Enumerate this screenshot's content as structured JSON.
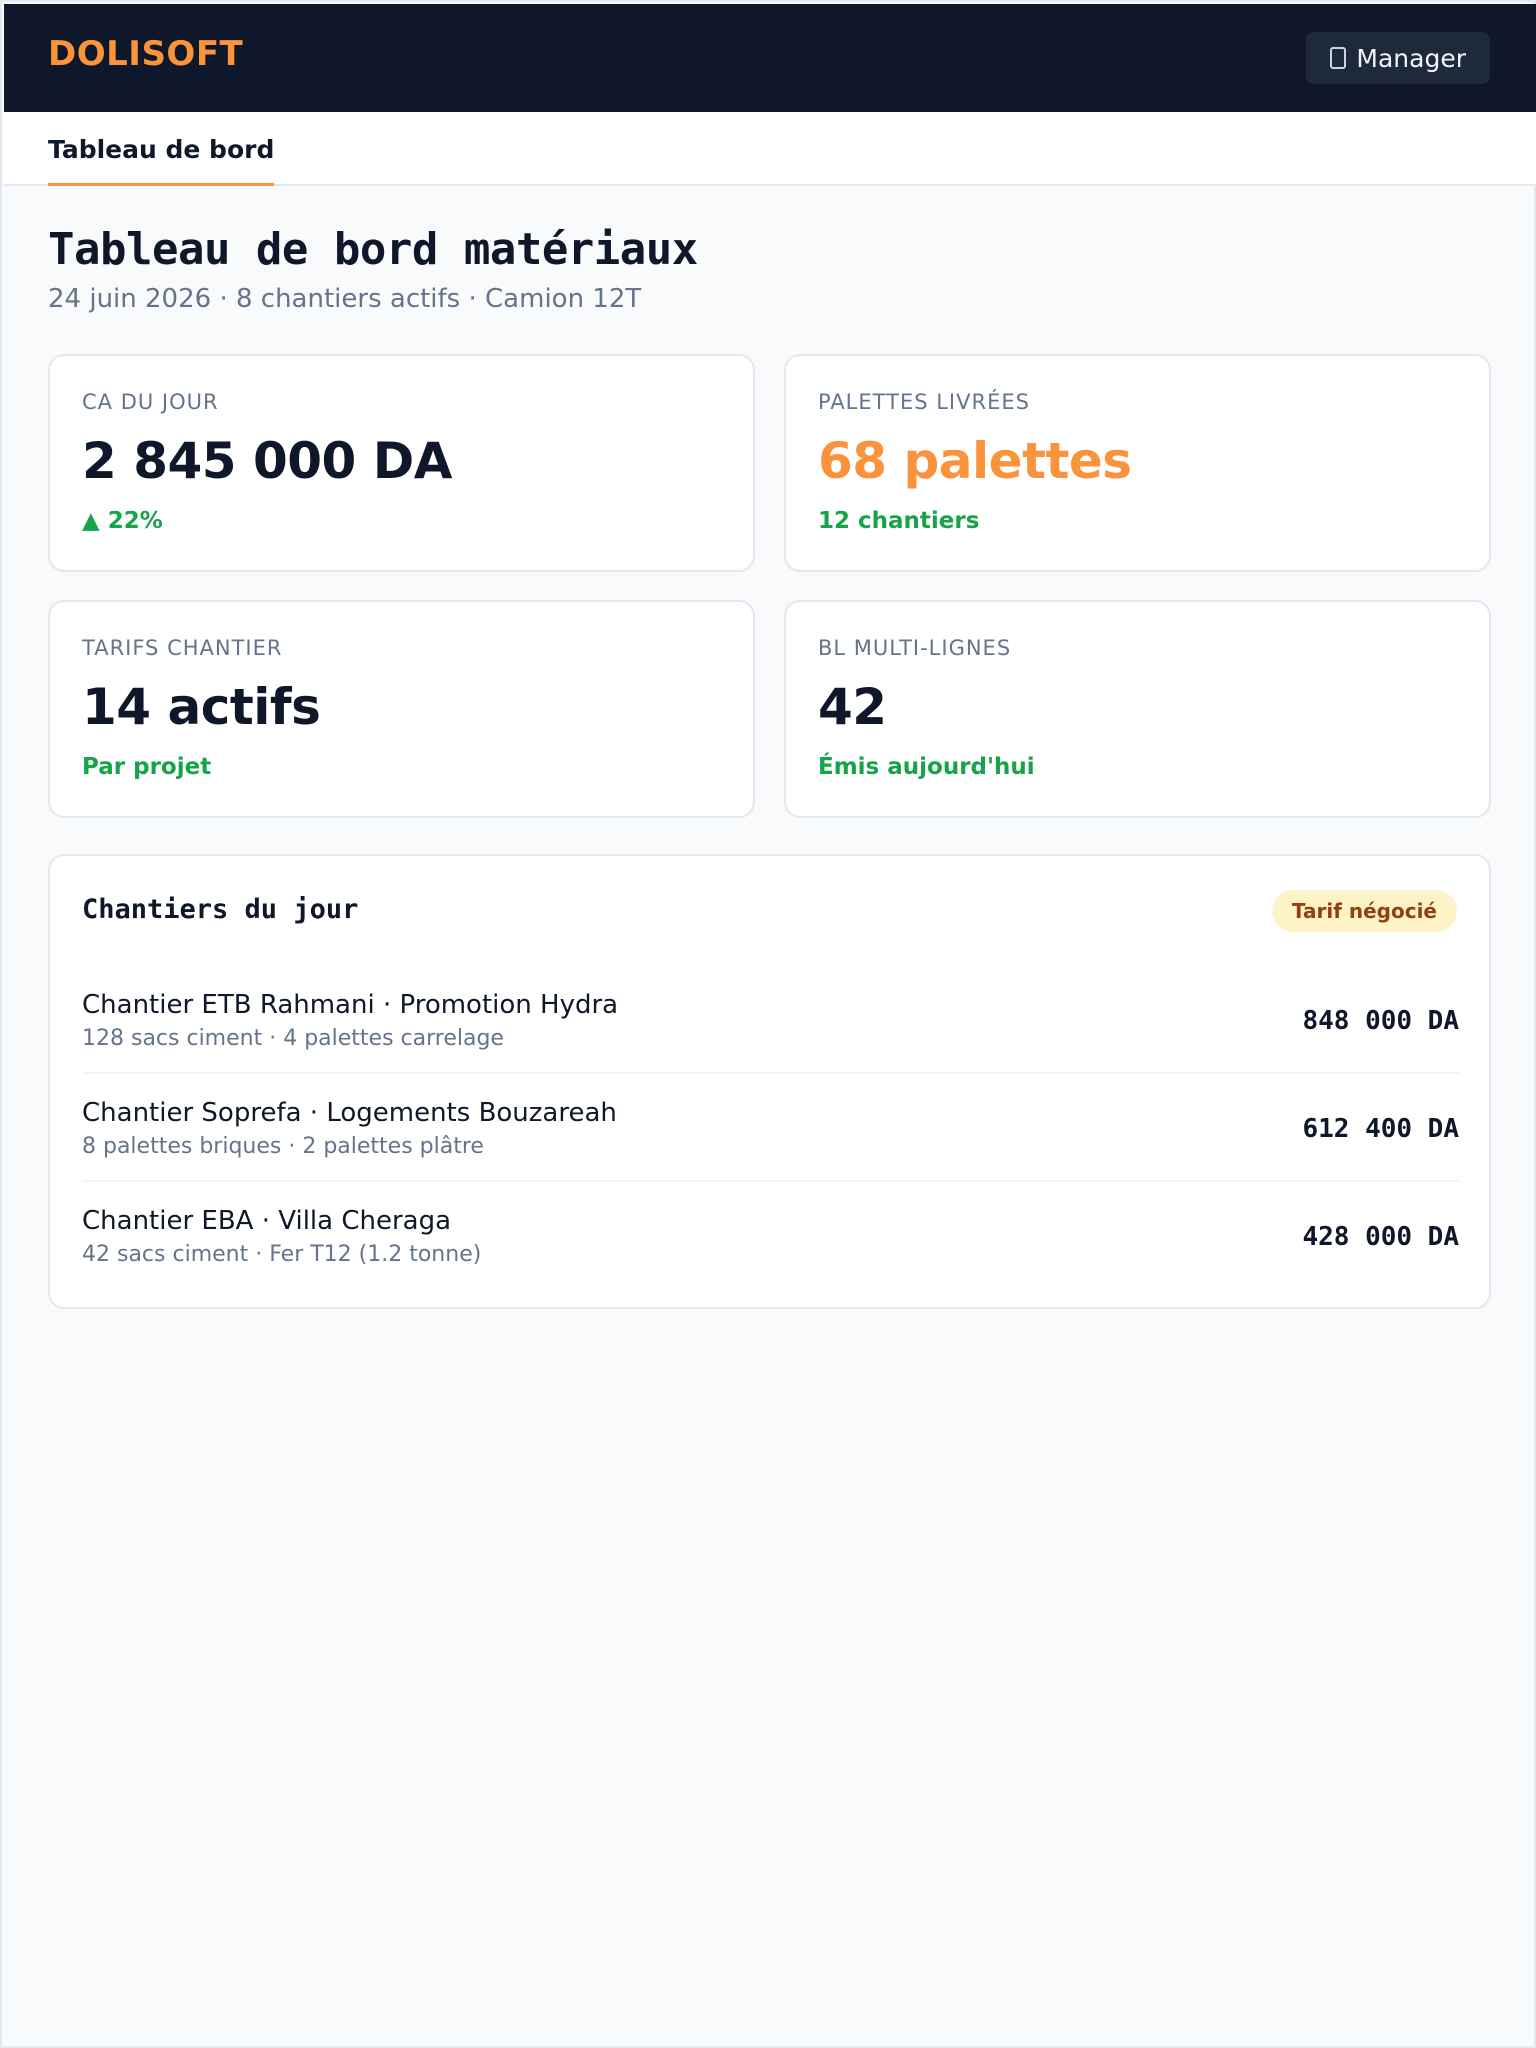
{
  "header": {
    "brand": "DOLISOFT",
    "user_label": "Manager",
    "user_icon": "user-icon"
  },
  "tabs": [
    {
      "label": "Tableau de bord",
      "active": true
    }
  ],
  "page": {
    "title": "Tableau de bord matériaux",
    "subtitle": "24 juin 2026 · 8 chantiers actifs · Camion 12T"
  },
  "kpis": [
    {
      "label": "CA du jour",
      "value": "2 845 000 DA",
      "note": "▲ 22%"
    },
    {
      "label": "Palettes livrées",
      "value": "68 palettes",
      "note": "12 chantiers"
    },
    {
      "label": "Tarifs chantier",
      "value": "14 actifs",
      "note": "Par projet"
    },
    {
      "label": "BL multi-lignes",
      "value": "42",
      "note": "Émis aujourd'hui"
    }
  ],
  "sites_panel": {
    "title": "Chantiers du jour",
    "badge": "Tarif négocié",
    "rows": [
      {
        "title": "Chantier ETB Rahmani · Promotion Hydra",
        "detail": "128 sacs ciment · 4 palettes carrelage",
        "amount": "848 000 DA"
      },
      {
        "title": "Chantier Soprefa · Logements Bouzareah",
        "detail": "8 palettes briques · 2 palettes plâtre",
        "amount": "612 400 DA"
      },
      {
        "title": "Chantier EBA · Villa Cheraga",
        "detail": "42 sacs ciment · Fer T12 (1.2 tonne)",
        "amount": "428 000 DA"
      }
    ]
  },
  "colors": {
    "brand": "#fb923c",
    "topbar": "#0f172a",
    "positive": "#16a34a",
    "badge_bg": "#fef3c7",
    "badge_text": "#92400e"
  }
}
